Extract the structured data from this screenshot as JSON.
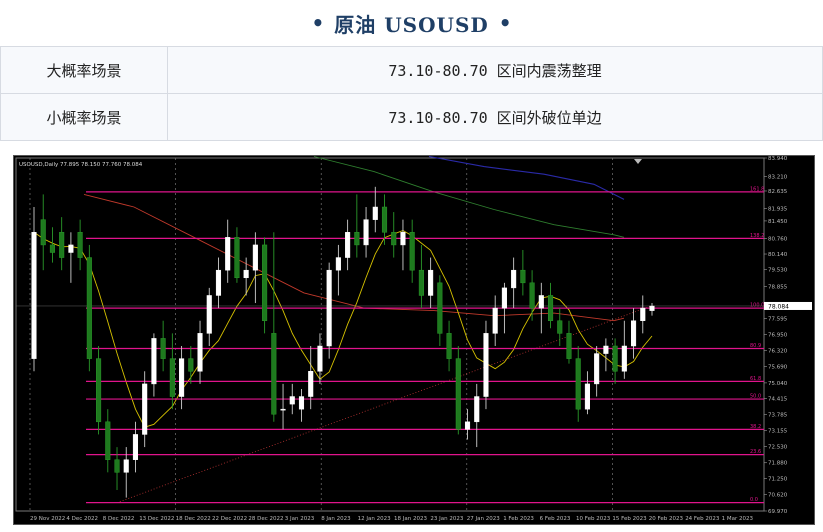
{
  "header": {
    "title": "原油  USOUSD"
  },
  "scenarios": [
    {
      "label": "大概率场景",
      "value": "73.10-80.70 区间内震荡整理"
    },
    {
      "label": "小概率场景",
      "value": "73.10-80.70 区间外破位单边"
    }
  ],
  "chart_data": {
    "type": "candlestick",
    "symbol_info": "USOUSD,Daily  77.895 78.150 77.760 78.084",
    "price_ticks": [
      "83.940",
      "83.210",
      "82.635",
      "81.935",
      "81.450",
      "80.760",
      "80.140",
      "79.530",
      "78.855",
      "78.084",
      "77.595",
      "76.950",
      "76.320",
      "75.690",
      "75.040",
      "74.415",
      "73.785",
      "73.155",
      "72.530",
      "71.880",
      "71.250",
      "70.620",
      "69.970"
    ],
    "date_labels": [
      "29 Nov 2022",
      "4 Dec 2022",
      "8 Dec 2022",
      "13 Dec 2022",
      "18 Dec 2022",
      "22 Dec 2022",
      "28 Dec 2022",
      "3 Jan 2023",
      "8 Jan 2023",
      "12 Jan 2023",
      "18 Jan 2023",
      "23 Jan 2023",
      "27 Jan 2023",
      "1 Feb 2023",
      "6 Feb 2023",
      "10 Feb 2023",
      "15 Feb 2023",
      "20 Feb 2023",
      "24 Feb 2023",
      "1 Mar 2023"
    ],
    "fib_levels": [
      {
        "label": "161.8",
        "price": 82.6
      },
      {
        "label": "138.2",
        "price": 80.76
      },
      {
        "label": "100.0",
        "price": 78.0
      },
      {
        "label": "80.9",
        "price": 76.4
      },
      {
        "label": "61.8",
        "price": 75.1
      },
      {
        "label": "50.0",
        "price": 74.4
      },
      {
        "label": "38.2",
        "price": 73.2
      },
      {
        "label": "23.6",
        "price": 72.2
      },
      {
        "label": "0.0",
        "price": 70.3
      }
    ],
    "current_price": 78.084,
    "candles": [
      {
        "o": 76.0,
        "h": 82.0,
        "l": 75.5,
        "c": 81.0
      },
      {
        "o": 81.5,
        "h": 82.5,
        "l": 79.5,
        "c": 80.5
      },
      {
        "o": 80.5,
        "h": 81.2,
        "l": 79.8,
        "c": 80.2
      },
      {
        "o": 81.0,
        "h": 81.6,
        "l": 79.5,
        "c": 80.0
      },
      {
        "o": 80.2,
        "h": 81.0,
        "l": 79.0,
        "c": 80.5
      },
      {
        "o": 81.0,
        "h": 81.5,
        "l": 79.5,
        "c": 80.0
      },
      {
        "o": 80.0,
        "h": 80.5,
        "l": 75.5,
        "c": 76.0
      },
      {
        "o": 76.0,
        "h": 76.5,
        "l": 73.0,
        "c": 73.5
      },
      {
        "o": 73.5,
        "h": 74.0,
        "l": 71.5,
        "c": 72.0
      },
      {
        "o": 72.0,
        "h": 72.5,
        "l": 70.8,
        "c": 71.5
      },
      {
        "o": 71.5,
        "h": 72.5,
        "l": 70.5,
        "c": 72.0
      },
      {
        "o": 72.0,
        "h": 73.5,
        "l": 71.5,
        "c": 73.0
      },
      {
        "o": 73.0,
        "h": 75.5,
        "l": 72.5,
        "c": 75.0
      },
      {
        "o": 75.0,
        "h": 77.0,
        "l": 74.5,
        "c": 76.8
      },
      {
        "o": 76.8,
        "h": 77.5,
        "l": 75.5,
        "c": 76.0
      },
      {
        "o": 76.0,
        "h": 77.0,
        "l": 74.0,
        "c": 74.5
      },
      {
        "o": 74.5,
        "h": 76.5,
        "l": 74.0,
        "c": 76.0
      },
      {
        "o": 76.0,
        "h": 76.5,
        "l": 75.0,
        "c": 75.5
      },
      {
        "o": 75.5,
        "h": 77.5,
        "l": 75.0,
        "c": 77.0
      },
      {
        "o": 77.0,
        "h": 78.8,
        "l": 76.5,
        "c": 78.5
      },
      {
        "o": 78.5,
        "h": 80.0,
        "l": 78.0,
        "c": 79.5
      },
      {
        "o": 79.5,
        "h": 81.5,
        "l": 79.0,
        "c": 80.8
      },
      {
        "o": 80.8,
        "h": 81.2,
        "l": 79.0,
        "c": 79.2
      },
      {
        "o": 79.2,
        "h": 80.0,
        "l": 78.5,
        "c": 79.5
      },
      {
        "o": 79.5,
        "h": 81.0,
        "l": 78.2,
        "c": 80.5
      },
      {
        "o": 80.5,
        "h": 80.8,
        "l": 77.0,
        "c": 77.5
      },
      {
        "o": 77.0,
        "h": 81.0,
        "l": 73.5,
        "c": 73.8
      },
      {
        "o": 74.0,
        "h": 75.0,
        "l": 73.2,
        "c": 74.0
      },
      {
        "o": 74.2,
        "h": 75.0,
        "l": 73.8,
        "c": 74.5
      },
      {
        "o": 74.0,
        "h": 74.8,
        "l": 73.5,
        "c": 74.5
      },
      {
        "o": 74.5,
        "h": 76.5,
        "l": 74.0,
        "c": 75.5
      },
      {
        "o": 75.5,
        "h": 77.0,
        "l": 75.0,
        "c": 76.5
      },
      {
        "o": 76.5,
        "h": 79.8,
        "l": 76.0,
        "c": 79.5
      },
      {
        "o": 79.5,
        "h": 80.5,
        "l": 78.5,
        "c": 80.0
      },
      {
        "o": 80.0,
        "h": 81.5,
        "l": 79.5,
        "c": 81.0
      },
      {
        "o": 81.0,
        "h": 82.5,
        "l": 80.0,
        "c": 80.5
      },
      {
        "o": 80.5,
        "h": 82.0,
        "l": 80.0,
        "c": 81.5
      },
      {
        "o": 81.5,
        "h": 82.8,
        "l": 81.0,
        "c": 82.0
      },
      {
        "o": 82.0,
        "h": 82.5,
        "l": 80.5,
        "c": 81.0
      },
      {
        "o": 81.0,
        "h": 81.8,
        "l": 80.0,
        "c": 80.5
      },
      {
        "o": 80.5,
        "h": 81.5,
        "l": 79.5,
        "c": 81.0
      },
      {
        "o": 81.0,
        "h": 81.5,
        "l": 79.0,
        "c": 79.5
      },
      {
        "o": 79.5,
        "h": 80.5,
        "l": 78.0,
        "c": 78.5
      },
      {
        "o": 78.5,
        "h": 80.0,
        "l": 78.0,
        "c": 79.5
      },
      {
        "o": 79.0,
        "h": 79.3,
        "l": 76.5,
        "c": 77.0
      },
      {
        "o": 77.0,
        "h": 77.5,
        "l": 75.5,
        "c": 76.0
      },
      {
        "o": 76.0,
        "h": 76.5,
        "l": 73.0,
        "c": 73.2
      },
      {
        "o": 73.2,
        "h": 74.0,
        "l": 72.8,
        "c": 73.5
      },
      {
        "o": 73.5,
        "h": 75.0,
        "l": 72.5,
        "c": 74.5
      },
      {
        "o": 74.5,
        "h": 77.5,
        "l": 74.0,
        "c": 77.0
      },
      {
        "o": 77.0,
        "h": 78.5,
        "l": 76.5,
        "c": 78.0
      },
      {
        "o": 78.0,
        "h": 79.0,
        "l": 77.0,
        "c": 78.8
      },
      {
        "o": 78.8,
        "h": 80.0,
        "l": 78.0,
        "c": 79.5
      },
      {
        "o": 79.5,
        "h": 80.3,
        "l": 78.5,
        "c": 79.0
      },
      {
        "o": 79.0,
        "h": 79.5,
        "l": 77.5,
        "c": 78.0
      },
      {
        "o": 78.0,
        "h": 79.0,
        "l": 77.0,
        "c": 78.5
      },
      {
        "o": 78.5,
        "h": 79.0,
        "l": 77.2,
        "c": 77.5
      },
      {
        "o": 77.5,
        "h": 78.0,
        "l": 76.5,
        "c": 77.0
      },
      {
        "o": 77.0,
        "h": 77.5,
        "l": 75.8,
        "c": 76.0
      },
      {
        "o": 76.0,
        "h": 76.5,
        "l": 73.5,
        "c": 74.0
      },
      {
        "o": 74.0,
        "h": 75.5,
        "l": 73.8,
        "c": 75.0
      },
      {
        "o": 75.0,
        "h": 76.5,
        "l": 74.5,
        "c": 76.2
      },
      {
        "o": 76.2,
        "h": 76.8,
        "l": 75.5,
        "c": 76.5
      },
      {
        "o": 76.5,
        "h": 76.8,
        "l": 75.0,
        "c": 75.5
      },
      {
        "o": 75.5,
        "h": 77.5,
        "l": 75.2,
        "c": 76.5
      },
      {
        "o": 76.5,
        "h": 78.0,
        "l": 76.0,
        "c": 77.5
      },
      {
        "o": 77.5,
        "h": 78.5,
        "l": 77.0,
        "c": 78.0
      },
      {
        "o": 77.9,
        "h": 78.2,
        "l": 77.7,
        "c": 78.08
      }
    ],
    "ma_fast_color": "#d6c200",
    "ma_mid_color": "#c0392b",
    "ma_slow_color": "#2e7d2e",
    "ma_long_color": "#2a2aa8",
    "fib_color": "#e0148c",
    "bull_color": "#ffffff",
    "bear_color": "#1e7a1e"
  }
}
